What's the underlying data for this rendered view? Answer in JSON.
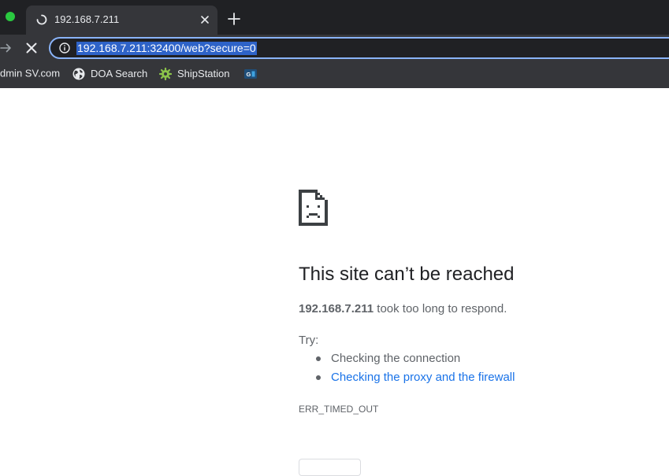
{
  "tab": {
    "title": "192.168.7.211"
  },
  "toolbar": {
    "url": "192.168.7.211:32400/web?secure=0"
  },
  "bookmarks": [
    {
      "label": "dmin SV.com",
      "icon": "none"
    },
    {
      "label": "DOA Search",
      "icon": "globe-icon"
    },
    {
      "label": "ShipStation",
      "icon": "gear-icon"
    },
    {
      "label": "",
      "icon": "gs-favicon"
    }
  ],
  "error": {
    "title": "This site can’t be reached",
    "host": "192.168.7.211",
    "message": "took too long to respond.",
    "try_label": "Try:",
    "suggestions": [
      {
        "text": "Checking the connection",
        "is_link": false
      },
      {
        "text": "Checking the proxy and the firewall",
        "is_link": true
      }
    ],
    "code": "ERR_TIMED_OUT"
  },
  "colors": {
    "link": "#1a73e8",
    "body_text": "#5f6368",
    "heading": "#202124",
    "chrome_dark": "#202124",
    "chrome_toolbar": "#35363a",
    "url_highlight": "#2e63c8",
    "focus_ring": "#8ab4f8"
  }
}
